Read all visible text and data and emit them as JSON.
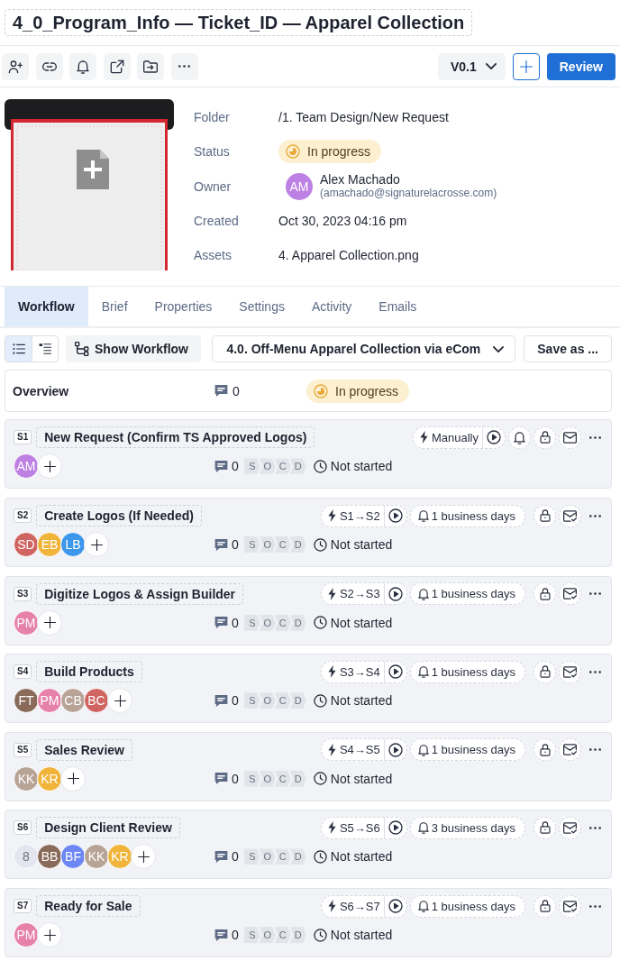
{
  "title": "4_0_Program_Info — Ticket_ID — Apparel Collection",
  "toolbar": {
    "version": "V0.1",
    "review": "Review"
  },
  "details": {
    "fields": [
      {
        "kind": "text",
        "label": "Folder",
        "value": "/1. Team Design/New Request"
      },
      {
        "kind": "status",
        "label": "Status",
        "value": "In progress"
      },
      {
        "kind": "owner",
        "label": "Owner",
        "initials": "AM",
        "color": "#bd80e3",
        "name": "Alex Machado",
        "email": "(amachado@signaturelacrosse.com)"
      },
      {
        "kind": "text",
        "label": "Created",
        "value": "Oct 30, 2023 04:16 pm"
      },
      {
        "kind": "text",
        "label": "Assets",
        "value": "4. Apparel Collection.png"
      }
    ]
  },
  "tabs": [
    {
      "label": "Workflow",
      "selected": true
    },
    {
      "label": "Brief",
      "selected": false
    },
    {
      "label": "Properties",
      "selected": false
    },
    {
      "label": "Settings",
      "selected": false
    },
    {
      "label": "Activity",
      "selected": false
    },
    {
      "label": "Emails",
      "selected": false
    }
  ],
  "workflow_bar": {
    "views": [
      {
        "selected": true
      },
      {
        "selected": false
      }
    ],
    "show_workflow": "Show Workflow",
    "template": "4.0. Off-Menu Apparel Collection via eCom",
    "save_as": "Save as ..."
  },
  "overview": {
    "title": "Overview",
    "comments": "0",
    "status": "In progress"
  },
  "stages": [
    {
      "badge": "S1",
      "title": "New Request (Confirm TS Approved Logos)",
      "trigger": "Manually",
      "email_checked": false,
      "assignees": [
        {
          "initials": "AM",
          "color": "#bd80e3"
        }
      ],
      "comments": "0",
      "steps": [
        "S",
        "O",
        "C",
        "D"
      ],
      "status": "Not started"
    },
    {
      "badge": "S2",
      "title": "Create Logos (If Needed)",
      "trigger": "S1→S2",
      "reminder": "1 business days",
      "email_checked": true,
      "assignees": [
        {
          "initials": "SD",
          "color": "#cf6461"
        },
        {
          "initials": "EB",
          "color": "#f0b43a"
        },
        {
          "initials": "LB",
          "color": "#3d97ea"
        }
      ],
      "comments": "0",
      "steps": [
        "S",
        "O",
        "C",
        "D"
      ],
      "status": "Not started"
    },
    {
      "badge": "S3",
      "title": "Digitize Logos & Assign Builder",
      "trigger": "S2→S3",
      "reminder": "1 business days",
      "email_checked": true,
      "assignees": [
        {
          "initials": "PM",
          "color": "#e681aa"
        }
      ],
      "comments": "0",
      "steps": [
        "S",
        "O",
        "C",
        "D"
      ],
      "status": "Not started"
    },
    {
      "badge": "S4",
      "title": "Build Products",
      "trigger": "S3→S4",
      "reminder": "1 business days",
      "email_checked": true,
      "assignees": [
        {
          "initials": "FT",
          "color": "#8a6b5a"
        },
        {
          "initials": "PM",
          "color": "#e681aa"
        },
        {
          "initials": "CB",
          "color": "#b8a397"
        },
        {
          "initials": "BC",
          "color": "#cf6461"
        }
      ],
      "comments": "0",
      "steps": [
        "S",
        "O",
        "C",
        "D"
      ],
      "status": "Not started"
    },
    {
      "badge": "S5",
      "title": "Sales Review",
      "trigger": "S4→S5",
      "reminder": "1 business days",
      "email_checked": true,
      "assignees": [
        {
          "initials": "KK",
          "color": "#b8a397"
        },
        {
          "initials": "KR",
          "color": "#f0b43a"
        }
      ],
      "comments": "0",
      "steps": [
        "S",
        "O",
        "C",
        "D"
      ],
      "status": "Not started"
    },
    {
      "badge": "S6",
      "title": "Design Client Review",
      "trigger": "S5→S6",
      "reminder": "3 business days",
      "email_checked": true,
      "hidden_count": "8",
      "assignees": [
        {
          "initials": "BB",
          "color": "#8a6b5a"
        },
        {
          "initials": "BF",
          "color": "#6d87f5"
        },
        {
          "initials": "KK",
          "color": "#b8a397"
        },
        {
          "initials": "KR",
          "color": "#f0b43a"
        }
      ],
      "comments": "0",
      "steps": [
        "S",
        "O",
        "C",
        "D"
      ],
      "status": "Not started"
    },
    {
      "badge": "S7",
      "title": "Ready for Sale",
      "trigger": "S6→S7",
      "reminder": "1 business days",
      "email_checked": true,
      "assignees": [
        {
          "initials": "PM",
          "color": "#e681aa"
        }
      ],
      "comments": "0",
      "steps": [
        "S",
        "O",
        "C",
        "D"
      ],
      "status": "Not started"
    }
  ]
}
